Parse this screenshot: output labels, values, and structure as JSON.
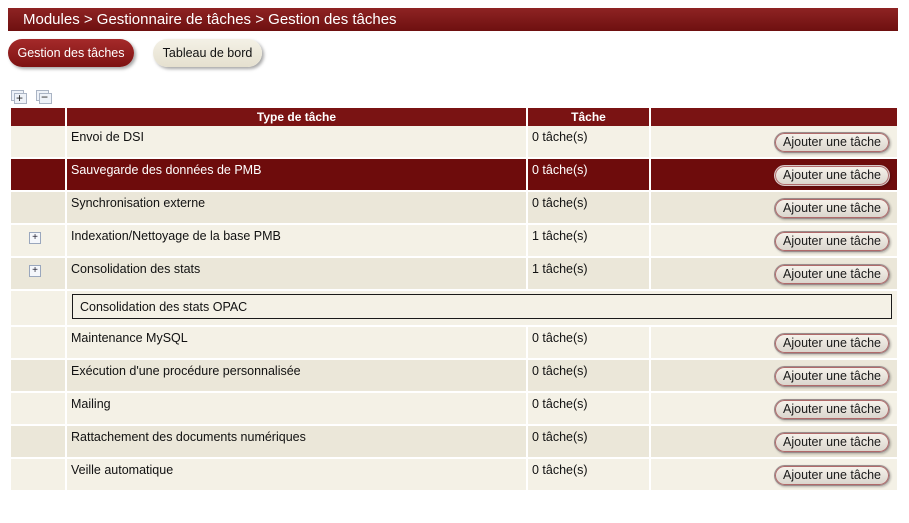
{
  "breadcrumb": "Modules > Gestionnaire de tâches > Gestion des tâches",
  "tabs": {
    "active": "Gestion des tâches",
    "inactive": "Tableau de bord"
  },
  "tree_tools": {
    "expand_icon": "expand-all-icon",
    "collapse_icon": "collapse-all-icon"
  },
  "table": {
    "headers": {
      "empty": "",
      "type": "Type de tâche",
      "task": "Tâche",
      "actions": ""
    },
    "add_label": "Ajouter une tâche",
    "rows": [
      {
        "type": "Envoi de DSI",
        "count": "0 tâche(s)"
      },
      {
        "type": "Sauvegarde des données de PMB",
        "count": "0 tâche(s)"
      },
      {
        "type": "Synchronisation externe",
        "count": "0 tâche(s)"
      },
      {
        "type": "Indexation/Nettoyage de la base PMB",
        "count": "1 tâche(s)",
        "expander": "+"
      },
      {
        "type": "Consolidation des stats",
        "count": "1 tâche(s)",
        "expander": "+"
      },
      {
        "type": "Maintenance MySQL",
        "count": "0 tâche(s)"
      },
      {
        "type": "Exécution d'une procédure personnalisée",
        "count": "0 tâche(s)"
      },
      {
        "type": "Mailing",
        "count": "0 tâche(s)"
      },
      {
        "type": "Rattachement des documents numériques",
        "count": "0 tâche(s)"
      },
      {
        "type": "Veille automatique",
        "count": "0 tâche(s)"
      }
    ],
    "subtask": "Consolidation des stats OPAC"
  },
  "colors": {
    "header": "#7a1313",
    "selected_row": "#6e0c0c",
    "row_bg": "#f4f1e6"
  }
}
